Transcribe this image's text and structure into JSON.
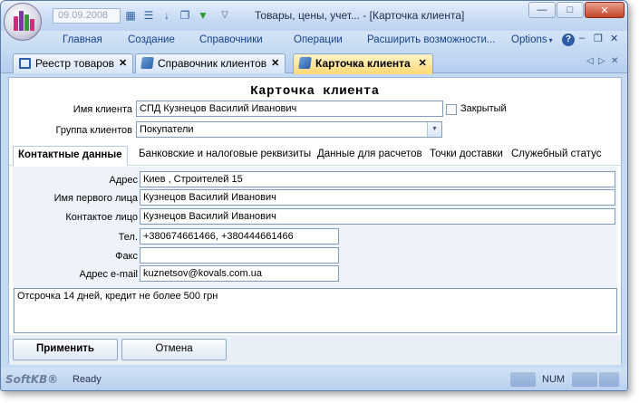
{
  "toolbar": {
    "date_value": "09.09.2008",
    "icons": [
      "app-logo-icon",
      "calendar-icon",
      "list-icon",
      "sort-down-icon",
      "copy-icon",
      "filter-icon",
      "customize-qat-icon"
    ]
  },
  "window": {
    "title": "Товары, цены, учет... - [Карточка клиента]",
    "controls": [
      "minimize-icon",
      "maximize-icon",
      "close-icon"
    ]
  },
  "ribbon": {
    "items": [
      "Главная",
      "Создание",
      "Справочники",
      "Операции",
      "Расширить возможности...",
      "Options"
    ],
    "options_arrow": "▾",
    "help_glyph": "?"
  },
  "doc_tabs": {
    "tabs": [
      {
        "label": "Реестр товаров",
        "close": "✕"
      },
      {
        "label": "Справочник клиентов",
        "close": "✕"
      },
      {
        "label": "Карточка клиента",
        "close": "✕"
      }
    ],
    "active": "Карточка клиента"
  },
  "card": {
    "title": "Карточка клиента",
    "client_name_label": "Имя клиента",
    "client_name_value": "СПД Кузнецов Василий Иванович",
    "closed_label": "Закрытый",
    "closed_checked": false,
    "client_group_label": "Группа клиентов",
    "client_group_value": "Покупатели"
  },
  "inner_tabs": [
    "Контактные данные",
    "Банковские и налоговые реквизиты",
    "Данные для расчетов",
    "Точки доставки",
    "Служебный статус"
  ],
  "contact": {
    "address_label": "Адрес",
    "address_value": "Киев , Строителей 15",
    "first_person_label": "Имя первого лица",
    "first_person_value": "Кузнецов Василий Иванович",
    "contact_person_label": "Контактое лицо",
    "contact_person_value": "Кузнецов Василий Иванович",
    "phone_label": "Тел.",
    "phone_value": "+380674661466, +380444661466",
    "fax_label": "Факс",
    "fax_value": "",
    "email_label": "Адрес e-mail",
    "email_value": "kuznetsov@kovals.com.ua",
    "notes": "Отсрочка 14 дней, кредит не более 500 грн"
  },
  "buttons": {
    "apply": "Применить",
    "cancel": "Отмена"
  },
  "status": {
    "brand": "SoftKB®",
    "text": "Ready",
    "num": "NUM"
  }
}
